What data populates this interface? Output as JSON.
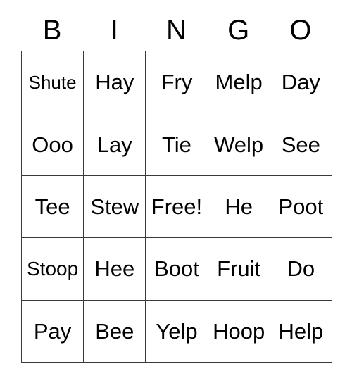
{
  "card": {
    "headers": [
      "B",
      "I",
      "N",
      "G",
      "O"
    ],
    "rows": [
      [
        {
          "label": "Shute",
          "size": "sm"
        },
        {
          "label": "Hay",
          "size": "lg"
        },
        {
          "label": "Fry",
          "size": "lg"
        },
        {
          "label": "Melp",
          "size": "lg"
        },
        {
          "label": "Day",
          "size": "lg"
        }
      ],
      [
        {
          "label": "Ooo",
          "size": "lg"
        },
        {
          "label": "Lay",
          "size": "lg"
        },
        {
          "label": "Tie",
          "size": "lg"
        },
        {
          "label": "Welp",
          "size": "lg"
        },
        {
          "label": "See",
          "size": "lg"
        }
      ],
      [
        {
          "label": "Tee",
          "size": "lg"
        },
        {
          "label": "Stew",
          "size": "lg"
        },
        {
          "label": "Free!",
          "size": "lg"
        },
        {
          "label": "He",
          "size": "lg"
        },
        {
          "label": "Poot",
          "size": "lg"
        }
      ],
      [
        {
          "label": "Stoop",
          "size": "md"
        },
        {
          "label": "Hee",
          "size": "lg"
        },
        {
          "label": "Boot",
          "size": "lg"
        },
        {
          "label": "Fruit",
          "size": "lg"
        },
        {
          "label": "Do",
          "size": "lg"
        }
      ],
      [
        {
          "label": "Pay",
          "size": "lg"
        },
        {
          "label": "Bee",
          "size": "lg"
        },
        {
          "label": "Yelp",
          "size": "lg"
        },
        {
          "label": "Hoop",
          "size": "lg"
        },
        {
          "label": "Help",
          "size": "lg"
        }
      ]
    ],
    "free_space": {
      "row": 2,
      "column": 2,
      "label": "Free!"
    },
    "colors": {
      "background": "#ffffff",
      "text": "#000000",
      "border": "#3a3a3a"
    }
  }
}
